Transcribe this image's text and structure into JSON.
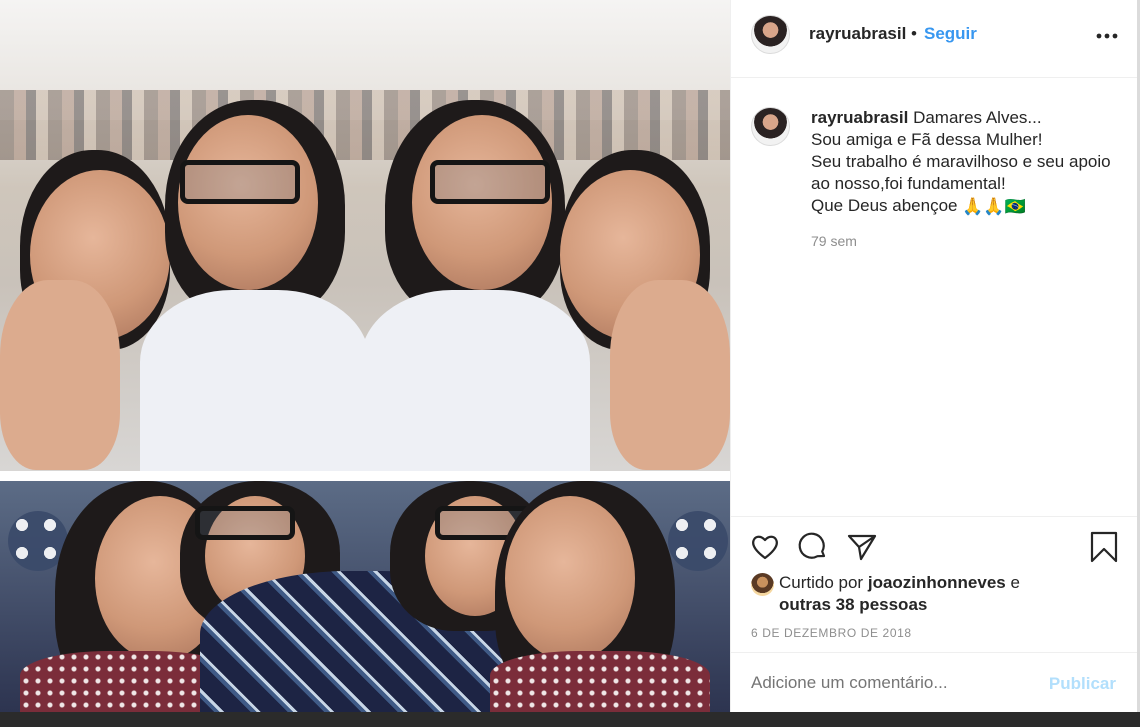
{
  "post": {
    "username": "rayruabrasil",
    "separator": "•",
    "follow_label": "Seguir",
    "more_label": "•••"
  },
  "caption": {
    "username": "rayruabrasil",
    "lines": [
      "Damares Alves...",
      "Sou amiga e Fã dessa Mulher!",
      "Seu trabalho é maravilhoso e seu apoio ao nosso,foi fundamental!",
      "Que Deus abençoe"
    ],
    "emoji": "🙏🙏🇧🇷",
    "age": "79 sem"
  },
  "likes": {
    "prefix": "Curtido por",
    "user": "joaozinhonneves",
    "connector": "e",
    "others": "outras 38 pessoas"
  },
  "date": "6 DE DEZEMBRO DE 2018",
  "comment": {
    "placeholder": "Adicione um comentário...",
    "publish_label": "Publicar"
  },
  "icons": {
    "like": "heart-icon",
    "comment": "comment-icon",
    "share": "paper-plane-icon",
    "save": "bookmark-icon",
    "more": "more-options-icon"
  },
  "colors": {
    "link": "#3897f0",
    "publish_disabled": "#b2dffc",
    "muted": "#8e8e8e"
  }
}
